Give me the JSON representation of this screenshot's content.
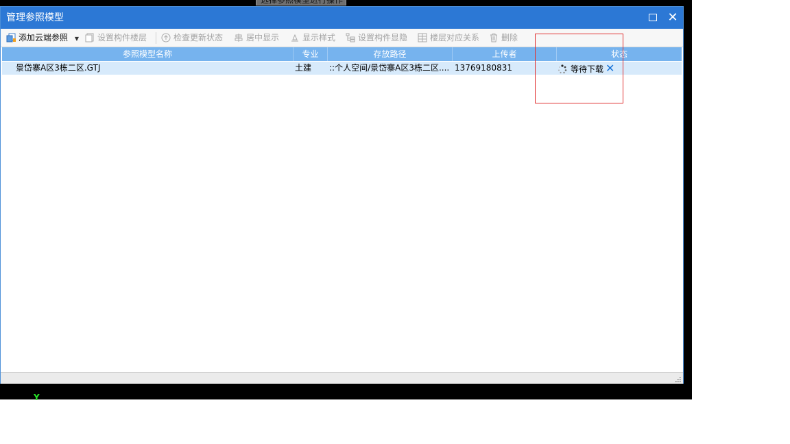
{
  "background": {
    "tooltip_text": "选择参照模型进行操作",
    "axis_label": "Y"
  },
  "dialog": {
    "title": "管理参照模型",
    "maximize_label": "",
    "close_label": "✕"
  },
  "toolbar": {
    "add_cloud_ref": "添加云端参照",
    "set_component_floor": "设置构件楼层",
    "check_update_status": "检查更新状态",
    "center_display": "居中显示",
    "display_style": "显示样式",
    "set_component_visibility": "设置构件显隐",
    "floor_mapping": "楼层对应关系",
    "delete": "删除"
  },
  "table": {
    "columns": [
      "参照模型名称",
      "专业",
      "存放路径",
      "上传者",
      "状态"
    ],
    "rows": [
      {
        "name": "景岱寨A区3栋二区.GTJ",
        "discipline": "土建",
        "path": "::个人空间/景岱寨A区3栋二区....",
        "uploader": "13769180831",
        "status": "等待下载"
      }
    ]
  },
  "colors": {
    "titlebar": "#2c78d5",
    "header": "#76b3ee",
    "selected_row": "#d7eafb",
    "highlight_box": "#e03030"
  }
}
